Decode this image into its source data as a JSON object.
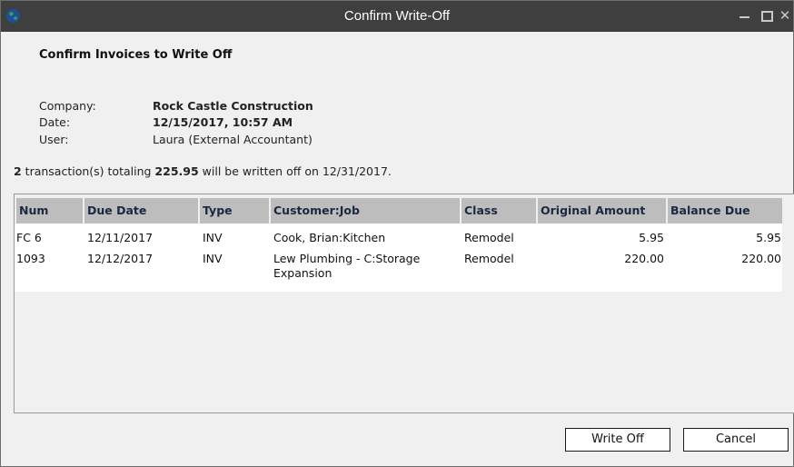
{
  "window": {
    "title": "Confirm Write-Off"
  },
  "heading": "Confirm Invoices to Write Off",
  "info": {
    "company_label": "Company:",
    "company_value": "Rock Castle Construction",
    "date_label": "Date:",
    "date_value": "12/15/2017, 10:57 AM",
    "user_label": "User:",
    "user_value": "Laura (External Accountant)"
  },
  "summary": {
    "count": "2",
    "text1": " transaction(s) totaling ",
    "total": "225.95",
    "text2": " will be written off on 12/31/2017."
  },
  "table": {
    "columns": [
      "Num",
      "Due Date",
      "Type",
      "Customer:Job",
      "Class",
      "Original Amount",
      "Balance Due"
    ],
    "rows": [
      {
        "num": "FC 6",
        "due_date": "12/11/2017",
        "type": "INV",
        "customer_job": "Cook, Brian:Kitchen",
        "class": "Remodel",
        "original_amount": "5.95",
        "balance_due": "5.95"
      },
      {
        "num": "1093",
        "due_date": "12/12/2017",
        "type": "INV",
        "customer_job": "Lew Plumbing - C:Storage Expansion",
        "class": "Remodel",
        "original_amount": "220.00",
        "balance_due": "220.00"
      }
    ]
  },
  "buttons": {
    "write_off": "Write Off",
    "cancel": "Cancel"
  }
}
